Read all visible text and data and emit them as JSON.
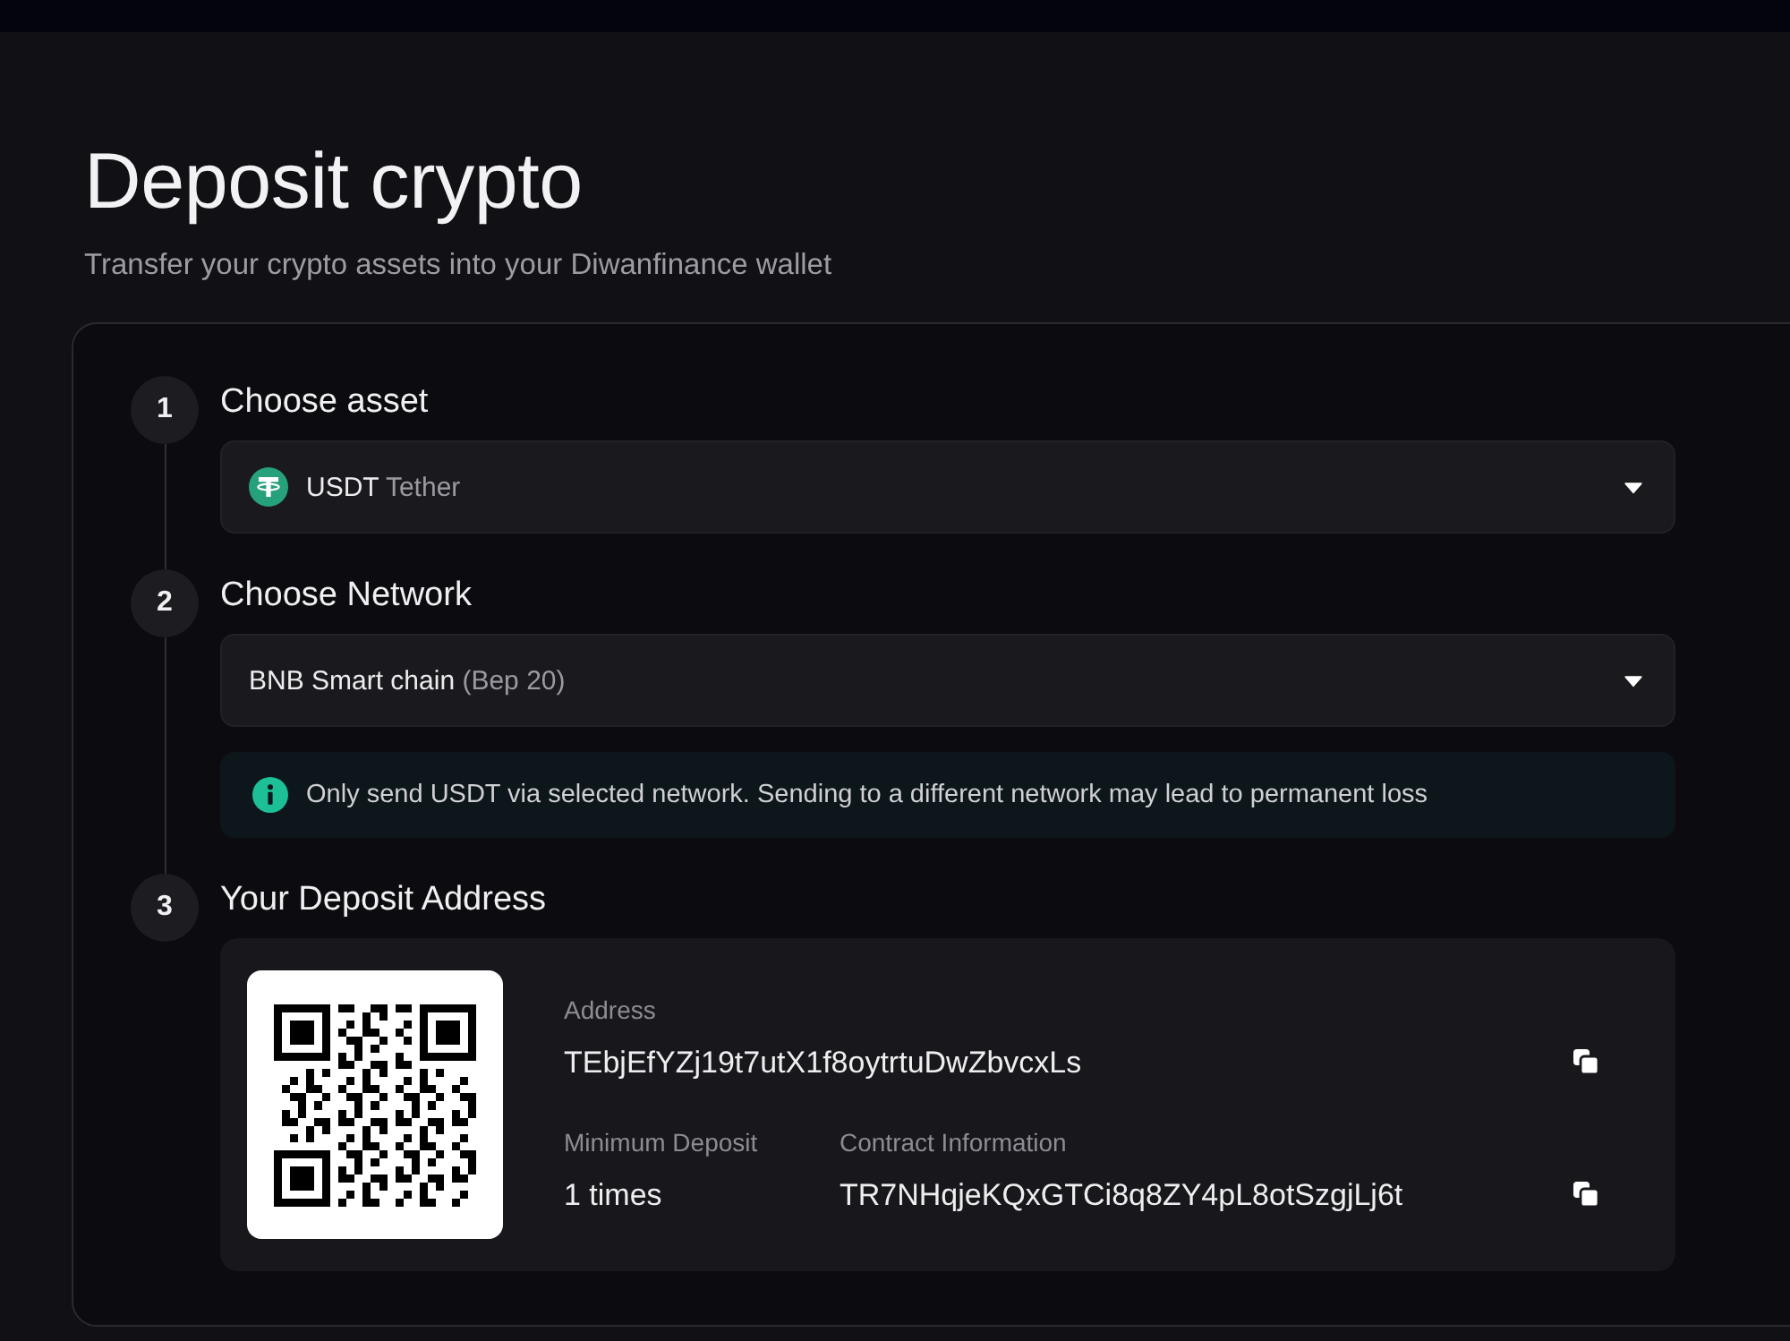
{
  "page": {
    "title": "Deposit crypto",
    "subtitle": "Transfer your crypto assets into your Diwanfinance wallet"
  },
  "steps": [
    {
      "number": "1",
      "title": "Choose asset",
      "kind": "asset_select",
      "asset": {
        "symbol": "USDT",
        "name": "Tether"
      }
    },
    {
      "number": "2",
      "title": "Choose Network",
      "kind": "network_select",
      "network": {
        "name": "BNB Smart chain",
        "standard": "(Bep 20)"
      },
      "notice": "Only send USDT via selected network. Sending to a different network may lead to permanent loss"
    },
    {
      "number": "3",
      "title": "Your Deposit Address",
      "kind": "address",
      "address": {
        "label": "Address",
        "value": "TEbjEfYZj19t7utX1f8oytrtuDwZbvcxLs"
      },
      "minimum_deposit": {
        "label": "Minimum Deposit",
        "value": "1 times"
      },
      "contract": {
        "label": "Contract Information",
        "value": "TR7NHqjeKQxGTCi8q8ZY4pL8otSzgjLj6t"
      }
    }
  ]
}
